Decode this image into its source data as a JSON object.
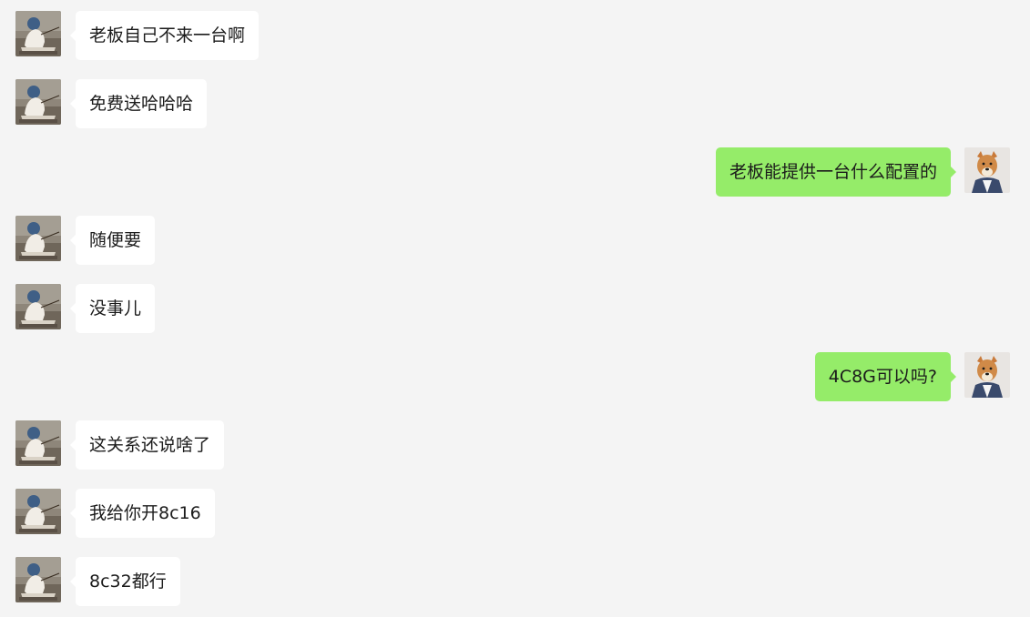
{
  "messages": [
    {
      "side": "left",
      "text": "老板自己不来一台啊"
    },
    {
      "side": "left",
      "text": "免费送哈哈哈"
    },
    {
      "side": "right",
      "text": "老板能提供一台什么配置的"
    },
    {
      "side": "left",
      "text": "随便要"
    },
    {
      "side": "left",
      "text": "没事儿"
    },
    {
      "side": "right",
      "text": "4C8G可以吗?"
    },
    {
      "side": "left",
      "text": "这关系还说啥了"
    },
    {
      "side": "left",
      "text": "我给你开8c16"
    },
    {
      "side": "left",
      "text": "8c32都行"
    }
  ],
  "colors": {
    "background": "#f4f4f4",
    "incoming_bubble": "#ffffff",
    "outgoing_bubble": "#95ec69"
  }
}
